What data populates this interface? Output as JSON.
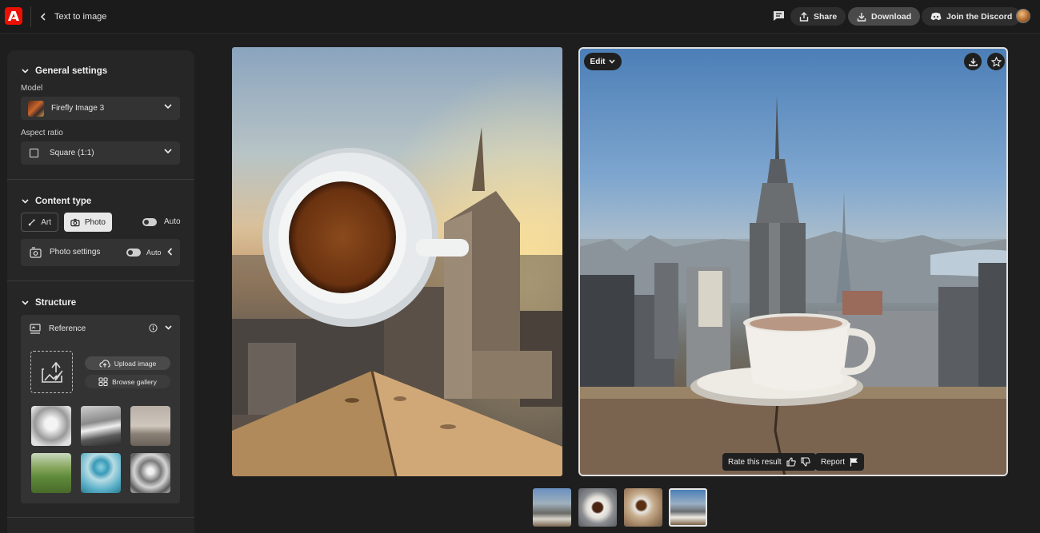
{
  "topbar": {
    "back_label": "Text to image",
    "share_label": "Share",
    "download_label": "Download",
    "discord_label": "Join the Discord"
  },
  "general": {
    "title": "General settings",
    "model_label": "Model",
    "model_value": "Firefly Image 3",
    "aspect_label": "Aspect ratio",
    "aspect_value": "Square (1:1)"
  },
  "content_type": {
    "title": "Content type",
    "art_label": "Art",
    "photo_label": "Photo",
    "auto_label": "Auto",
    "photo_settings_label": "Photo settings",
    "photo_settings_auto": "Auto"
  },
  "structure": {
    "title": "Structure",
    "reference_label": "Reference",
    "upload_label": "Upload image",
    "browse_label": "Browse gallery"
  },
  "result": {
    "edit_label": "Edit",
    "rate_label": "Rate this result",
    "report_label": "Report"
  },
  "colors": {
    "accent_red": "#eb1000",
    "background": "#1e1e1e",
    "panel": "#262626"
  }
}
